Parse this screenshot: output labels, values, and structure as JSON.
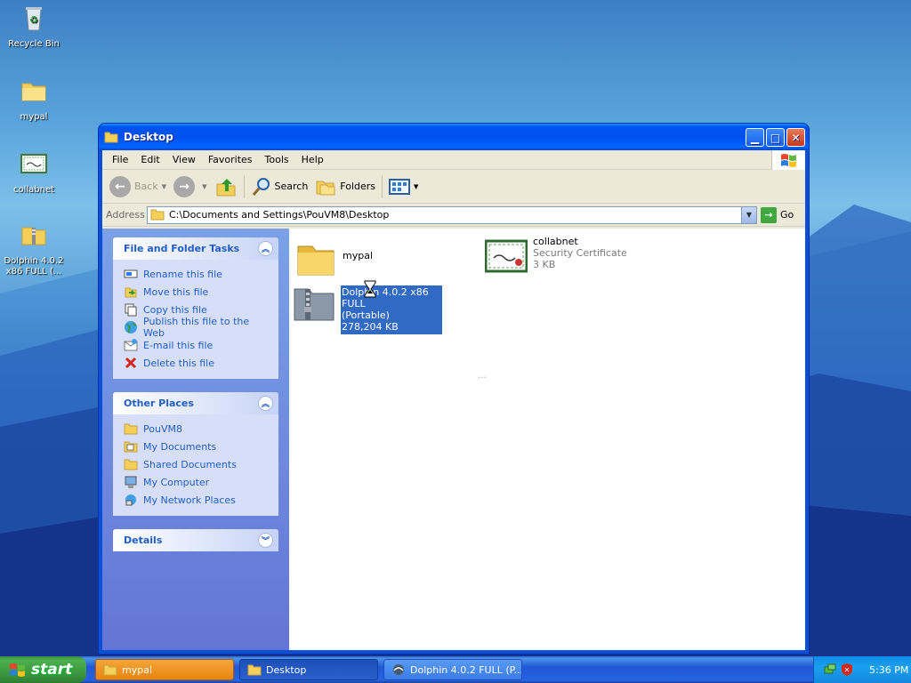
{
  "desktop": {
    "icons": [
      {
        "label": "Recycle Bin",
        "icon": "recycle-bin-icon"
      },
      {
        "label": "mypal",
        "icon": "folder-icon"
      },
      {
        "label": "collabnet",
        "icon": "certificate-icon"
      },
      {
        "label": "Dolphin 4.0.2 x86 FULL (...",
        "icon": "zip-folder-icon"
      }
    ]
  },
  "window": {
    "title": "Desktop",
    "menu": [
      "File",
      "Edit",
      "View",
      "Favorites",
      "Tools",
      "Help"
    ],
    "toolbar": {
      "back": "Back",
      "search": "Search",
      "folders": "Folders"
    },
    "address": {
      "label": "Address",
      "value": "C:\\Documents and Settings\\PouVM8\\Desktop",
      "go": "Go"
    },
    "tasks": {
      "title": "File and Folder Tasks",
      "items": [
        {
          "label": "Rename this file",
          "icon": "rename-icon"
        },
        {
          "label": "Move this file",
          "icon": "move-icon"
        },
        {
          "label": "Copy this file",
          "icon": "copy-icon"
        },
        {
          "label": "Publish this file to the Web",
          "icon": "globe-icon"
        },
        {
          "label": "E-mail this file",
          "icon": "email-icon"
        },
        {
          "label": "Delete this file",
          "icon": "delete-icon"
        }
      ]
    },
    "places": {
      "title": "Other Places",
      "items": [
        {
          "label": "PouVM8",
          "icon": "folder-icon"
        },
        {
          "label": "My Documents",
          "icon": "documents-icon"
        },
        {
          "label": "Shared Documents",
          "icon": "folder-icon"
        },
        {
          "label": "My Computer",
          "icon": "computer-icon"
        },
        {
          "label": "My Network Places",
          "icon": "network-icon"
        }
      ]
    },
    "details": {
      "title": "Details"
    },
    "files": [
      {
        "name": "mypal",
        "type": "",
        "size": "",
        "icon": "folder-icon"
      },
      {
        "name": "collabnet",
        "type": "Security Certificate",
        "size": "3 KB",
        "icon": "certificate-icon"
      },
      {
        "name_line1": "Dolphin 4.0.2 x86 FULL",
        "name_line2": "(Portable)",
        "size": "278,204 KB",
        "icon": "zip-folder-icon",
        "selected": true
      }
    ]
  },
  "taskbar": {
    "start": "start",
    "tasks": [
      {
        "label": "mypal",
        "state": "flashing"
      },
      {
        "label": "Desktop",
        "state": "active"
      },
      {
        "label": "Dolphin 4.0.2 FULL (P...",
        "state": "normal"
      }
    ],
    "clock": "5:36 PM"
  },
  "colors": {
    "titlebar": "#0053ee",
    "taskpane": "#6375d6",
    "link": "#215dc6",
    "selection": "#316ac5",
    "start_green": "#3c9a3f"
  }
}
